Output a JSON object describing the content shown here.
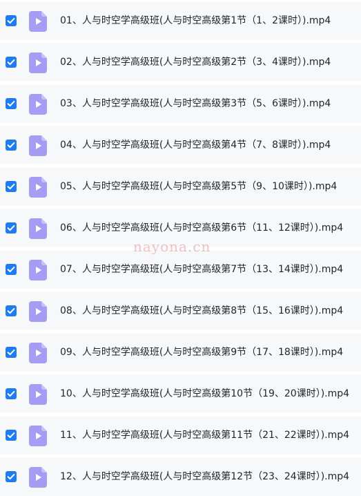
{
  "accent": {
    "checkbox": "#1e7cf2",
    "video_icon": "#a79cf3",
    "row_background": "#f7f8fa",
    "watermark": "#e87878"
  },
  "icons": {
    "checkbox": "checkmark-icon",
    "file": "video-file-icon"
  },
  "watermark": "nayona.cn",
  "files": [
    {
      "name": "01、人与时空学高级班(人与时空高级第1节（1、2课时）).mp4",
      "checked": true
    },
    {
      "name": "02、人与时空学高级班(人与时空高级第2节（3、4课时）).mp4",
      "checked": true
    },
    {
      "name": "03、人与时空学高级班(人与时空高级第3节（5、6课时）).mp4",
      "checked": true
    },
    {
      "name": "04、人与时空学高级班(人与时空高级第4节（7、8课时）).mp4",
      "checked": true
    },
    {
      "name": "05、人与时空学高级班(人与时空高级第5节（9、10课时）).mp4",
      "checked": true
    },
    {
      "name": "06、人与时空学高级班(人与时空高级第6节（11、12课时）).mp4",
      "checked": true
    },
    {
      "name": "07、人与时空学高级班(人与时空高级第7节（13、14课时）).mp4",
      "checked": true
    },
    {
      "name": "08、人与时空学高级班(人与时空高级第8节（15、16课时）).mp4",
      "checked": true
    },
    {
      "name": "09、人与时空学高级班(人与时空高级第9节（17、18课时）).mp4",
      "checked": true
    },
    {
      "name": "10、人与时空学高级班(人与时空高级第10节（19、20课时）).mp4",
      "checked": true
    },
    {
      "name": "11、人与时空学高级班(人与时空高级第11节（21、22课时）).mp4",
      "checked": true
    },
    {
      "name": "12、人与时空学高级班(人与时空高级第12节（23、24课时）).mp4",
      "checked": true
    }
  ]
}
